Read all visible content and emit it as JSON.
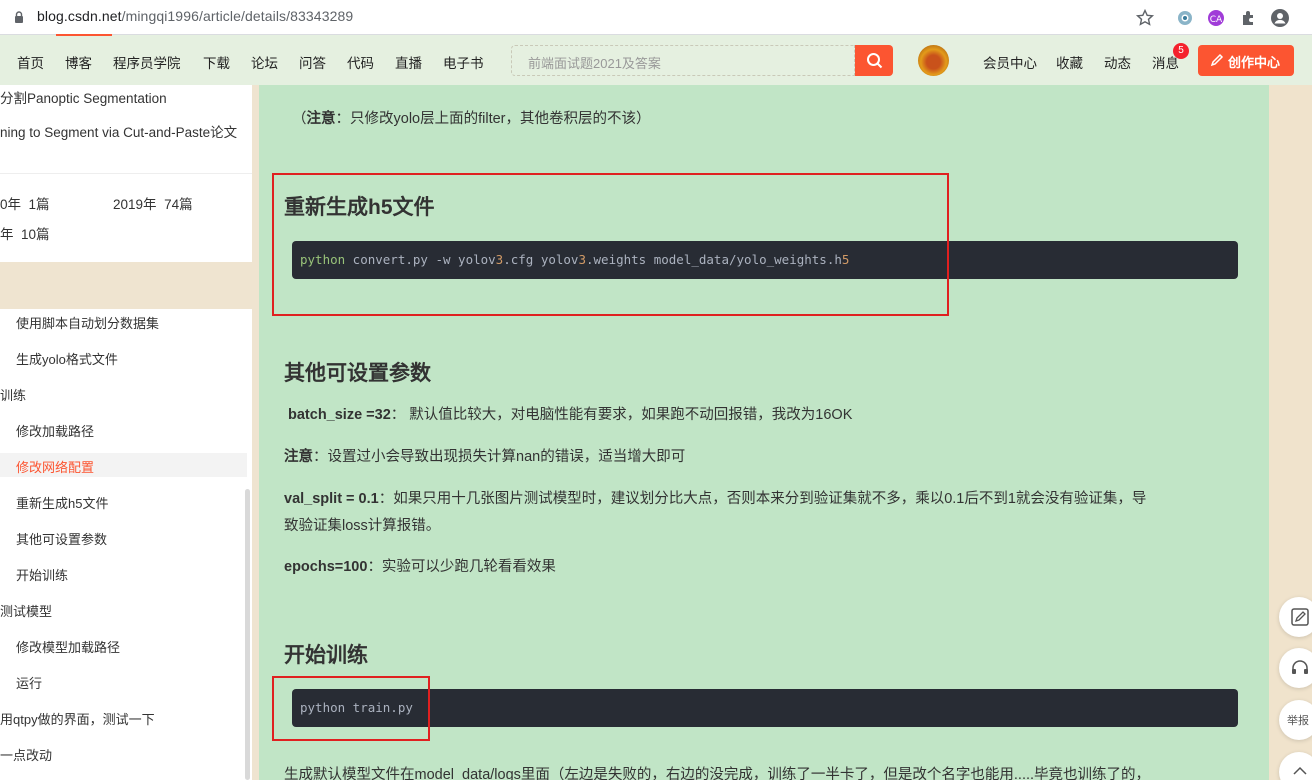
{
  "browser": {
    "url_host": "blog.csdn.net",
    "url_path": "/mingqi1996/article/details/83343289"
  },
  "nav": {
    "items": [
      "首页",
      "博客",
      "程序员学院",
      "下载",
      "论坛",
      "问答",
      "代码",
      "直播",
      "电子书"
    ],
    "search_placeholder": "前端面试题2021及答案",
    "right_items": [
      "会员中心",
      "收藏",
      "动态",
      "消息"
    ],
    "message_count": "5",
    "create_label": "创作中心",
    "accent": "#fc5531"
  },
  "sidebar": {
    "top_items": [
      "分割Panoptic Segmentation",
      "ning to Segment via Cut-and-Paste论文"
    ],
    "archive": [
      {
        "year": "0年",
        "count": "1篇"
      },
      {
        "year": "2019年",
        "count": "74篇"
      },
      {
        "year": "年",
        "count": "10篇"
      }
    ],
    "toc": [
      {
        "label": "使用脚本自动划分数据集",
        "level": 2
      },
      {
        "label": "生成yolo格式文件",
        "level": 2
      },
      {
        "label": "训练",
        "level": 1
      },
      {
        "label": "修改加载路径",
        "level": 2
      },
      {
        "label": "修改网络配置",
        "level": 2,
        "active": true
      },
      {
        "label": "重新生成h5文件",
        "level": 2
      },
      {
        "label": "其他可设置参数",
        "level": 2
      },
      {
        "label": "开始训练",
        "level": 2
      },
      {
        "label": "测试模型",
        "level": 1
      },
      {
        "label": "修改模型加载路径",
        "level": 2
      },
      {
        "label": "运行",
        "level": 2
      },
      {
        "label": "用qtpy做的界面，测试一下",
        "level": 1
      },
      {
        "label": "一点改动",
        "level": 1
      }
    ],
    "active_color": "#fc5531"
  },
  "article": {
    "note_prefix": "注意",
    "note_text": "：只修改yolo层上面的filter，其他卷积层的不该）",
    "h_regen": "重新生成h5文件",
    "code_convert": {
      "cmd": "python",
      "rest_a": " convert.py -w yolov",
      "n1": "3",
      "rest_b": ".cfg yolov",
      "n2": "3",
      "rest_c": ".weights model_data/yolo_weights.h",
      "n3": "5"
    },
    "h_params": "其他可设置参数",
    "batch_label": "batch_size =32",
    "batch_text": "：  默认值比较大，对电脑性能有要求，如果跑不动回报错，我改为16OK",
    "note2_label": "注意",
    "note2_text": "：设置过小会导致出现损失计算nan的错误，适当增大即可",
    "val_label": "val_split = 0.1",
    "val_text1": "：如果只用十几张图片测试模型时，建议划分比大点，否则本来分到验证集就不多，乘以0.1后不到1就会没有验证集，导",
    "val_text2": "致验证集loss计算报错。",
    "epochs_label": "epochs=100",
    "epochs_text": "：实验可以少跑几轮看看效果",
    "h_train": "开始训练",
    "code_train": "python train.py",
    "last_line": "生成默认模型文件在model_data/logs里面（左边是失败的，右边的没完成，训练了一半卡了，但是改个名字也能用.....毕竟也训练了的，"
  },
  "float": {
    "report": "举报"
  }
}
